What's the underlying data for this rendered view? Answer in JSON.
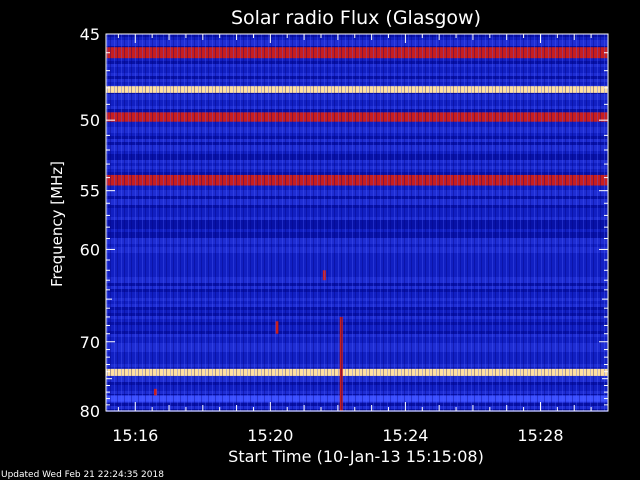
{
  "chart_data": {
    "type": "heatmap",
    "title": "Solar radio Flux (Glasgow)",
    "xlabel": "Start Time (10-Jan-13 15:15:08)",
    "ylabel": "Frequency [MHz]",
    "x_ticks": [
      "15:16",
      "15:20",
      "15:24",
      "15:28"
    ],
    "x_tick_minutes": [
      16,
      20,
      24,
      28
    ],
    "xlim_minutes": [
      15.133,
      30.0
    ],
    "y_ticks": [
      45,
      50,
      55,
      60,
      70,
      80
    ],
    "ylim": [
      45,
      80
    ],
    "y_scale": "reciprocal",
    "colors": {
      "background": "#000000",
      "low": "#0a14b4",
      "mid": "#3c50ff",
      "high": "#c81e1e",
      "peak": "#ffe0a0"
    },
    "bright_bands_mhz": [
      {
        "low": 45.7,
        "high": 46.3,
        "level": "high"
      },
      {
        "low": 47.9,
        "high": 48.3,
        "level": "peak"
      },
      {
        "low": 49.5,
        "high": 50.1,
        "level": "high"
      },
      {
        "low": 53.8,
        "high": 54.6,
        "level": "high"
      },
      {
        "low": 73.6,
        "high": 74.6,
        "level": "peak"
      },
      {
        "low": 77.5,
        "high": 78.5,
        "level": "mid"
      }
    ],
    "bursts": [
      {
        "minute": 21.6,
        "f_low": 62.0,
        "f_high": 63.0
      },
      {
        "minute": 22.1,
        "f_low": 67.0,
        "f_high": 80.0
      },
      {
        "minute": 20.2,
        "f_low": 67.5,
        "f_high": 69.0
      },
      {
        "minute": 16.6,
        "f_low": 76.5,
        "f_high": 77.5
      }
    ]
  },
  "footer": {
    "updated": "Updated Wed Feb 21 22:24:35 2018"
  }
}
